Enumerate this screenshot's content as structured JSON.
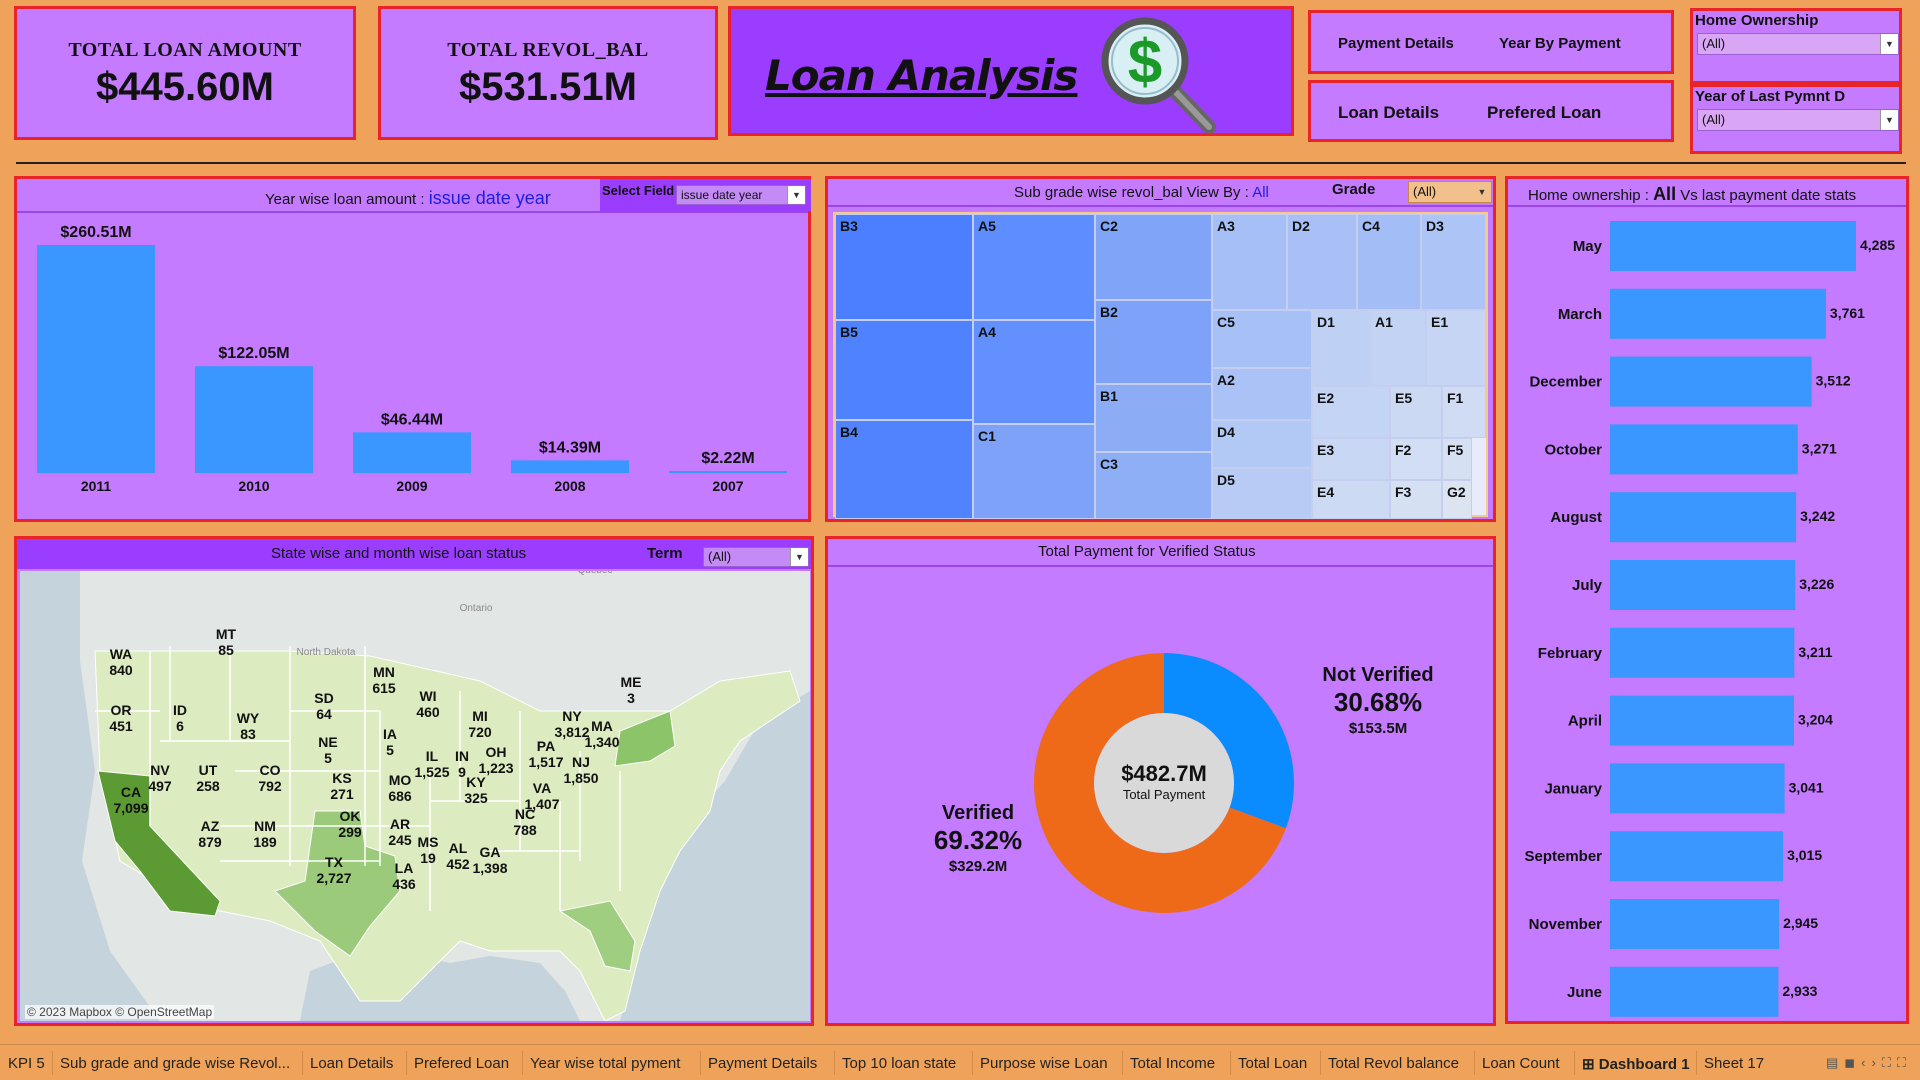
{
  "kpis": {
    "total_loan": {
      "label": "TOTAL LOAN AMOUNT",
      "value": "$445.60M"
    },
    "total_revol": {
      "label": "TOTAL REVOL_BAL",
      "value": "$531.51M"
    }
  },
  "header": {
    "title": "Loan Analysis",
    "nav": [
      "Payment Details",
      "Year By Payment",
      "Loan Details",
      "Prefered Loan"
    ]
  },
  "filters": {
    "home_ownership": {
      "label": "Home Ownership",
      "value": "(All)"
    },
    "year_last_pymnt": {
      "label": "Year of Last Pymnt D",
      "value": "(All)"
    }
  },
  "year_panel": {
    "title_prefix": "Year wise loan amount :",
    "title_field": "issue date year",
    "select_label": "Select Field",
    "select_value": "issue date year"
  },
  "subgrade_panel": {
    "title": "Sub grade wise revol_bal View By :",
    "title_all": "All",
    "grade_label": "Grade",
    "grade_value": "(All)",
    "cells": [
      "B3",
      "A5",
      "C2",
      "A3",
      "D2",
      "C4",
      "D3",
      "B5",
      "A4",
      "B2",
      "C5",
      "D1",
      "A1",
      "E1",
      "A2",
      "B1",
      "E2",
      "E5",
      "F1",
      "B4",
      "C1",
      "D4",
      "E3",
      "F2",
      "F5",
      "C3",
      "D5",
      "E4",
      "F3",
      "G2"
    ]
  },
  "home_panel": {
    "title_prefix": "Home ownership :",
    "title_all": "All",
    "title_suffix": "Vs last payment date stats"
  },
  "map_panel": {
    "title": "State wise and month wise loan status",
    "term_label": "Term",
    "term_value": "(All)",
    "credit": "© 2023 Mapbox © OpenStreetMap",
    "bg_labels": [
      "North Dakota",
      "Ontario",
      "Québec"
    ],
    "states": [
      {
        "abbr": "WA",
        "value": "840"
      },
      {
        "abbr": "OR",
        "value": "451"
      },
      {
        "abbr": "CA",
        "value": "7,099"
      },
      {
        "abbr": "ID",
        "value": "6"
      },
      {
        "abbr": "NV",
        "value": "497"
      },
      {
        "abbr": "MT",
        "value": "85"
      },
      {
        "abbr": "WY",
        "value": "83"
      },
      {
        "abbr": "UT",
        "value": "258"
      },
      {
        "abbr": "AZ",
        "value": "879"
      },
      {
        "abbr": "CO",
        "value": "792"
      },
      {
        "abbr": "NM",
        "value": "189"
      },
      {
        "abbr": "SD",
        "value": "64"
      },
      {
        "abbr": "NE",
        "value": "5"
      },
      {
        "abbr": "KS",
        "value": "271"
      },
      {
        "abbr": "OK",
        "value": "299"
      },
      {
        "abbr": "TX",
        "value": "2,727"
      },
      {
        "abbr": "MN",
        "value": "615"
      },
      {
        "abbr": "IA",
        "value": "5"
      },
      {
        "abbr": "MO",
        "value": "686"
      },
      {
        "abbr": "AR",
        "value": "245"
      },
      {
        "abbr": "LA",
        "value": "436"
      },
      {
        "abbr": "WI",
        "value": "460"
      },
      {
        "abbr": "IL",
        "value": "1,525"
      },
      {
        "abbr": "MS",
        "value": "19"
      },
      {
        "abbr": "MI",
        "value": "720"
      },
      {
        "abbr": "IN",
        "value": "9"
      },
      {
        "abbr": "KY",
        "value": "325"
      },
      {
        "abbr": "OH",
        "value": "1,223"
      },
      {
        "abbr": "AL",
        "value": "452"
      },
      {
        "abbr": "GA",
        "value": "1,398"
      },
      {
        "abbr": "NC",
        "value": "788"
      },
      {
        "abbr": "VA",
        "value": "1,407"
      },
      {
        "abbr": "PA",
        "value": "1,517"
      },
      {
        "abbr": "NY",
        "value": "3,812"
      },
      {
        "abbr": "NJ",
        "value": "1,850"
      },
      {
        "abbr": "MA",
        "value": "1,340"
      },
      {
        "abbr": "ME",
        "value": "3"
      }
    ]
  },
  "donut_panel": {
    "title": "Total Payment for Verified Status",
    "center_value": "$482.7M",
    "center_label": "Total Payment"
  },
  "tabs": [
    "KPI 5",
    "Sub grade and grade wise Revol...",
    "Loan Details",
    "Prefered Loan",
    "Year wise total pyment",
    "Payment Details",
    "Top 10 loan state",
    "Purpose wise Loan",
    "Total Income",
    "Total Loan",
    "Total Revol balance",
    "Loan Count",
    "Dashboard 1",
    "Sheet 17"
  ],
  "active_tab": "Dashboard 1",
  "colors": {
    "bar": "#3A97FF",
    "panel": "#C47BFF",
    "border": "#E8232A",
    "verified": "#EE6A18",
    "not_verified": "#0A8CFF"
  },
  "chart_data": [
    {
      "type": "bar",
      "categories": [
        "2011",
        "2010",
        "2009",
        "2008",
        "2007"
      ],
      "values": [
        260.51,
        122.05,
        46.44,
        14.39,
        2.22
      ],
      "labels": [
        "$260.51M",
        "$122.05M",
        "$46.44M",
        "$14.39M",
        "$2.22M"
      ]
    },
    {
      "type": "bar",
      "orientation": "horizontal",
      "categories": [
        "May",
        "March",
        "December",
        "October",
        "August",
        "July",
        "February",
        "April",
        "January",
        "September",
        "November",
        "June"
      ],
      "values": [
        4285,
        3761,
        3512,
        3271,
        3242,
        3226,
        3211,
        3204,
        3041,
        3015,
        2945,
        2933
      ],
      "labels": [
        "4,285",
        "3,761",
        "3,512",
        "3,271",
        "3,242",
        "3,226",
        "3,211",
        "3,204",
        "3,041",
        "3,015",
        "2,945",
        "2,933"
      ]
    },
    {
      "type": "pie",
      "categories": [
        "Verified",
        "Not Verified"
      ],
      "values": [
        69.32,
        30.68
      ],
      "pct_labels": [
        "69.32%",
        "30.68%"
      ],
      "amount_labels": [
        "$329.2M",
        "$153.5M"
      ]
    }
  ]
}
